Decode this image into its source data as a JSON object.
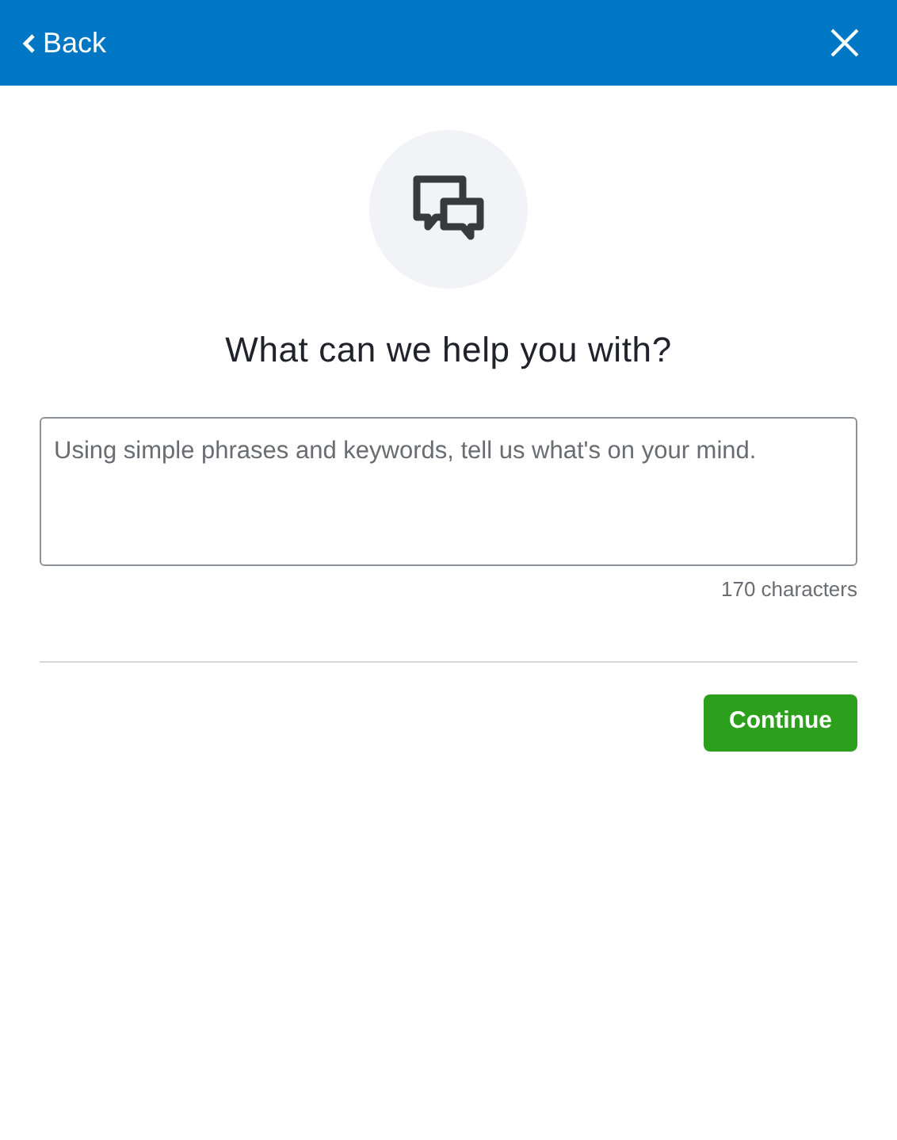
{
  "header": {
    "back": "Back"
  },
  "title": "What can we help you with?",
  "question": {
    "placeholder": "Using simple phrases and keywords, tell us what's on your mind.",
    "counter": "170 characters"
  },
  "button": "Continue"
}
